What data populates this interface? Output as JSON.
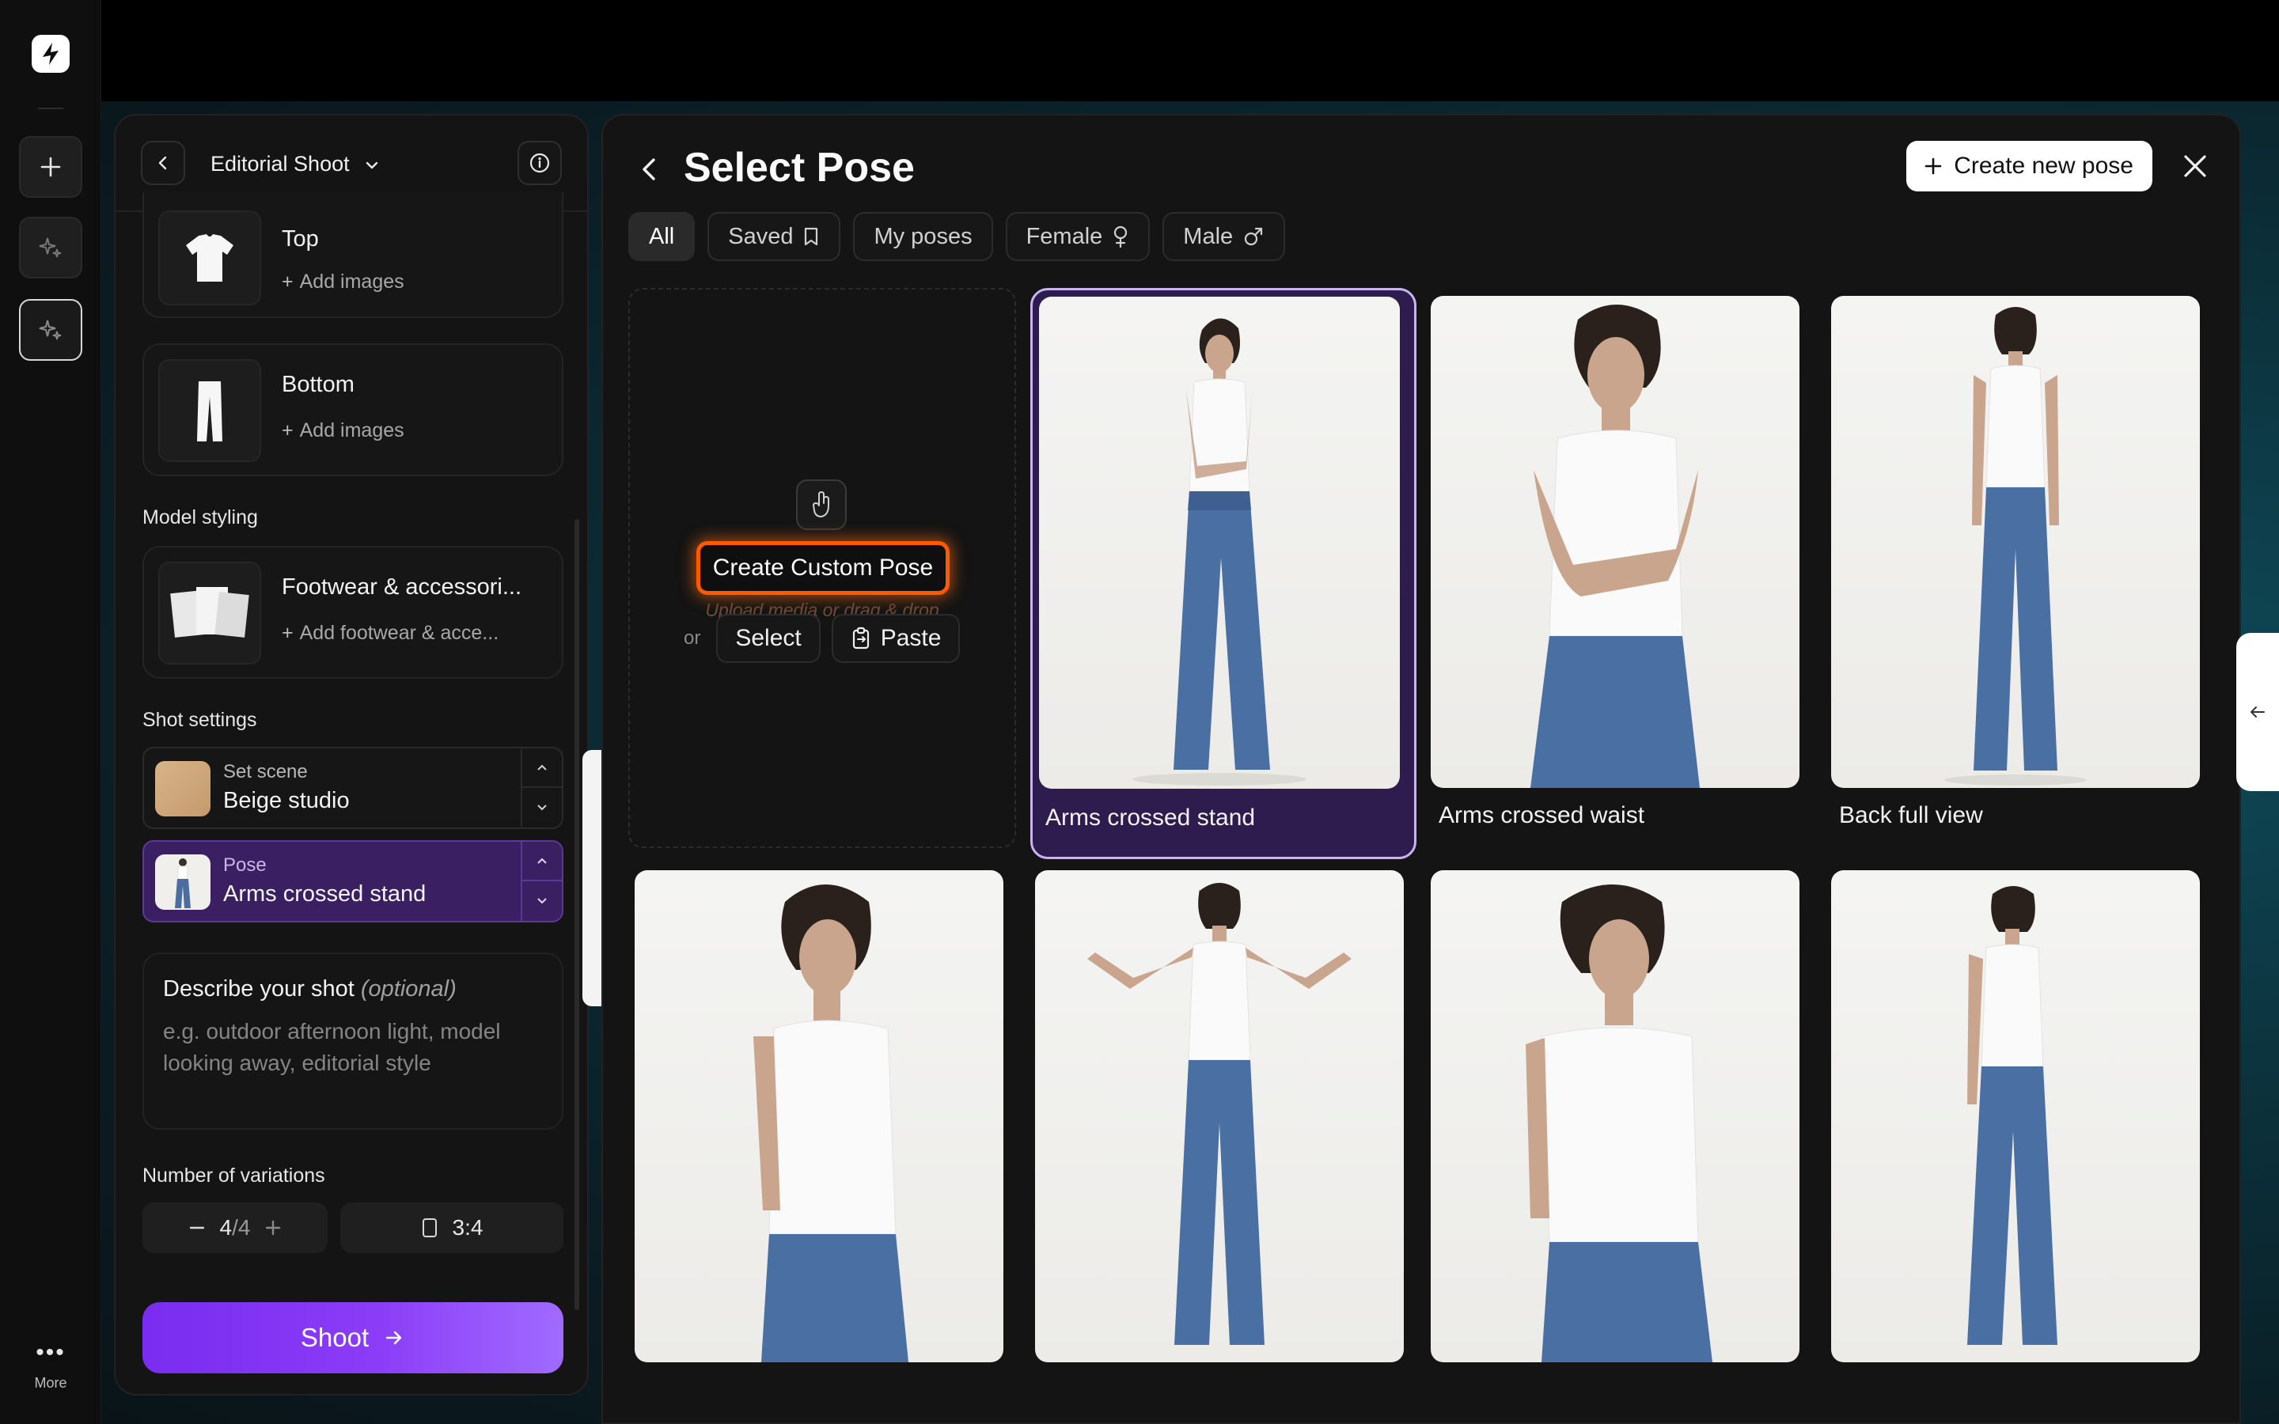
{
  "rail": {
    "more_label": "More"
  },
  "left_panel": {
    "title": "Editorial Shoot",
    "items": [
      {
        "title": "Top",
        "action": "Add images"
      },
      {
        "title": "Bottom",
        "action": "Add images"
      }
    ],
    "model_styling_label": "Model styling",
    "styling_item": {
      "title": "Footwear & accessori...",
      "action": "Add footwear & acce..."
    },
    "shot_settings_label": "Shot settings",
    "scene": {
      "key": "Set scene",
      "value": "Beige studio"
    },
    "pose": {
      "key": "Pose",
      "value": "Arms crossed stand"
    },
    "describe": {
      "title": "Describe your shot",
      "optional": "(optional)",
      "placeholder": "e.g. outdoor afternoon light, model looking away, editorial style"
    },
    "variations_label": "Number of variations",
    "variations_value": "4",
    "variations_total": "/4",
    "ratio": "3:4",
    "shoot_label": "Shoot"
  },
  "main": {
    "title": "Select Pose",
    "create_label": "Create new pose",
    "filters": [
      {
        "label": "All",
        "icon": ""
      },
      {
        "label": "Saved",
        "icon": "bookmark-icon"
      },
      {
        "label": "My poses",
        "icon": ""
      },
      {
        "label": "Female",
        "icon": "female-icon"
      },
      {
        "label": "Male",
        "icon": "male-icon"
      }
    ],
    "custom": {
      "button": "Create Custom Pose",
      "subtitle": "Upload media or drag & drop",
      "or": "or",
      "select": "Select",
      "paste": "Paste"
    },
    "poses": [
      {
        "label": "Arms crossed stand",
        "selected": true
      },
      {
        "label": "Arms crossed waist",
        "selected": false
      },
      {
        "label": "Back full view",
        "selected": false
      }
    ]
  },
  "colors": {
    "accent": "#8b3cf7",
    "selected_pose_bg": "#2f1c4e",
    "custom_glow": "#ff5a00"
  }
}
